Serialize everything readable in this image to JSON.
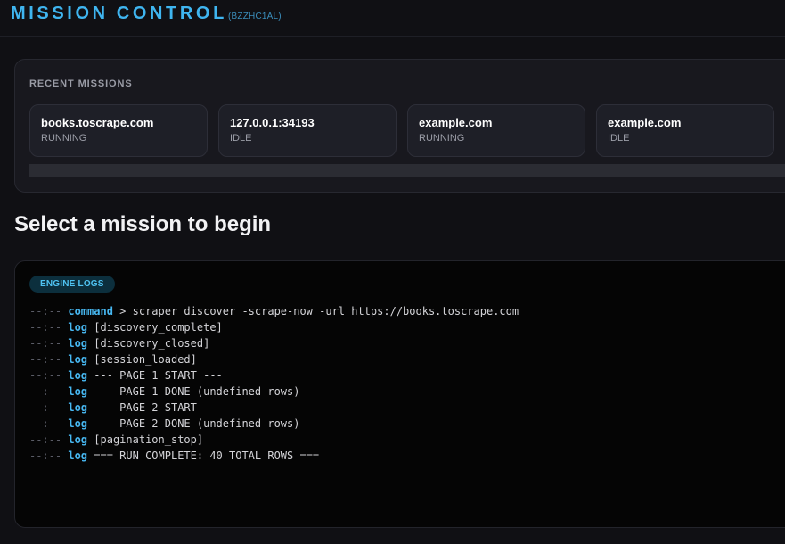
{
  "header": {
    "title": "MISSION CONTROL",
    "session_id": "(BZZHC1AL)"
  },
  "recent_missions": {
    "label": "RECENT MISSIONS",
    "items": [
      {
        "name": "books.toscrape.com",
        "status": "RUNNING"
      },
      {
        "name": "127.0.0.1:34193",
        "status": "IDLE"
      },
      {
        "name": "example.com",
        "status": "RUNNING"
      },
      {
        "name": "example.com",
        "status": "IDLE"
      }
    ]
  },
  "main": {
    "heading": "Select a mission to begin"
  },
  "engine_logs": {
    "badge": "ENGINE LOGS",
    "entries": [
      {
        "time": "--:--",
        "type": "command",
        "message": "> scraper discover -scrape-now -url https://books.toscrape.com"
      },
      {
        "time": "--:--",
        "type": "log",
        "message": "[discovery_complete]"
      },
      {
        "time": "--:--",
        "type": "log",
        "message": "[discovery_closed]"
      },
      {
        "time": "--:--",
        "type": "log",
        "message": "[session_loaded]"
      },
      {
        "time": "--:--",
        "type": "log",
        "message": "--- PAGE 1 START ---"
      },
      {
        "time": "--:--",
        "type": "log",
        "message": "--- PAGE 1 DONE (undefined rows) ---"
      },
      {
        "time": "--:--",
        "type": "log",
        "message": "--- PAGE 2 START ---"
      },
      {
        "time": "--:--",
        "type": "log",
        "message": "--- PAGE 2 DONE (undefined rows) ---"
      },
      {
        "time": "--:--",
        "type": "log",
        "message": "[pagination_stop]"
      },
      {
        "time": "--:--",
        "type": "log",
        "message": "=== RUN COMPLETE: 40 TOTAL ROWS ==="
      }
    ]
  },
  "colors": {
    "accent": "#3fb5f0",
    "background": "#101014",
    "panel": "#18181e",
    "log_background": "#050505"
  }
}
